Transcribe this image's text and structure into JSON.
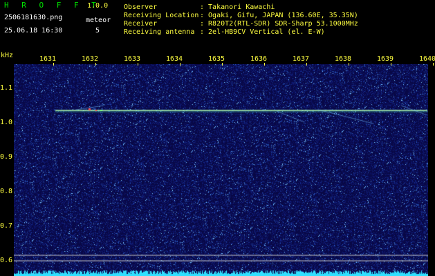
{
  "app": {
    "name": "H R O F F T",
    "version": "1.0.0",
    "filename": "2506181630.png",
    "datetime": "25.06.18 16:30",
    "meteor_label": "meteor",
    "meteor_count": "5"
  },
  "info": {
    "observer_label": "Observer",
    "observer_value": ": Takanori Kawachi",
    "location_label": "Receiving Location",
    "location_value": ": Ogaki, Gifu, JAPAN (136.60E, 35.35N)",
    "receiver_label": "Receiver",
    "receiver_value": ": R820T2(RTL-SDR) SDR-Sharp 53.1000MHz",
    "antenna_label": "Receiving antenna",
    "antenna_value": ": 2el-HB9CV Vertical (el. E-W)"
  },
  "axis": {
    "unit": "kHz",
    "x_ticks": [
      "1631",
      "1632",
      "1633",
      "1634",
      "1635",
      "1636",
      "1637",
      "1638",
      "1639",
      "1640"
    ],
    "y_ticks": [
      "1.1",
      "1.0",
      "0.9",
      "0.8",
      "0.7",
      "0.6"
    ]
  },
  "colors": {
    "background": "#000000",
    "spectrum_bg": "#0a0a4a",
    "label_yellow": "#ffff40",
    "title_green": "#00e000",
    "signal": "#b0ffb0"
  }
}
